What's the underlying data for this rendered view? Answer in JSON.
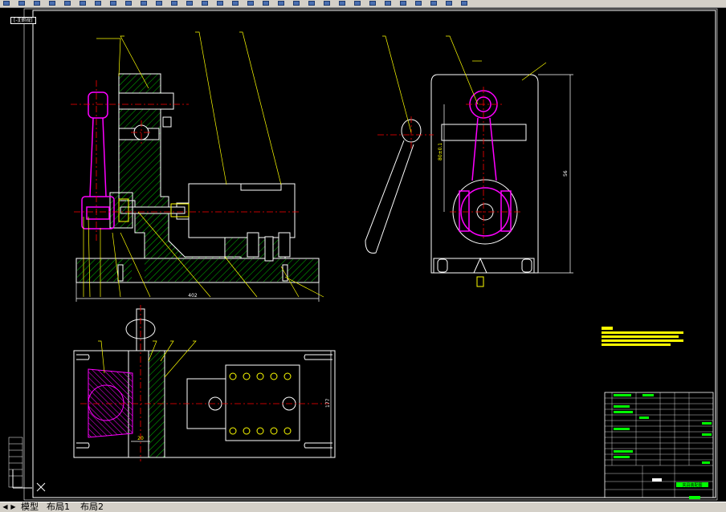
{
  "toolbar": {
    "icons": [
      "layer-icon",
      "layer-icon",
      "layer-icon",
      "layer-icon",
      "undo-icon",
      "properties-icon",
      "redo-icon",
      "layer-icon",
      "layer-icon",
      "layer-icon",
      "layer-icon",
      "layer-icon",
      "pan-icon",
      "zoom-icon",
      "zoom-window-icon",
      "zoom-previous-icon",
      "text-style-icon",
      "properties-icon",
      "properties-icon",
      "properties-icon",
      "properties-icon",
      "properties-icon",
      "table-icon",
      "layer-icon",
      "layer-icon",
      "layer-icon",
      "layer-icon",
      "layer-icon",
      "layer-icon",
      "layer-icon",
      "properties-icon"
    ]
  },
  "view_label": "[-][俯视]",
  "dimensions": {
    "front_width": "402",
    "top_height": "177",
    "side_height": "56",
    "side_small": "80±0.1",
    "top_small": "20"
  },
  "title_block": {
    "label": "夹具装配图"
  },
  "tabs": {
    "model": "模型",
    "layout1": "布局1",
    "layout2": "布局2"
  },
  "colors": {
    "background": "#000000",
    "outline": "#ffffff",
    "hatch": "#00c000",
    "part": "#ff00ff",
    "centerline": "#ff0000",
    "leader": "#ffff00",
    "highlight": "#00ff00"
  }
}
